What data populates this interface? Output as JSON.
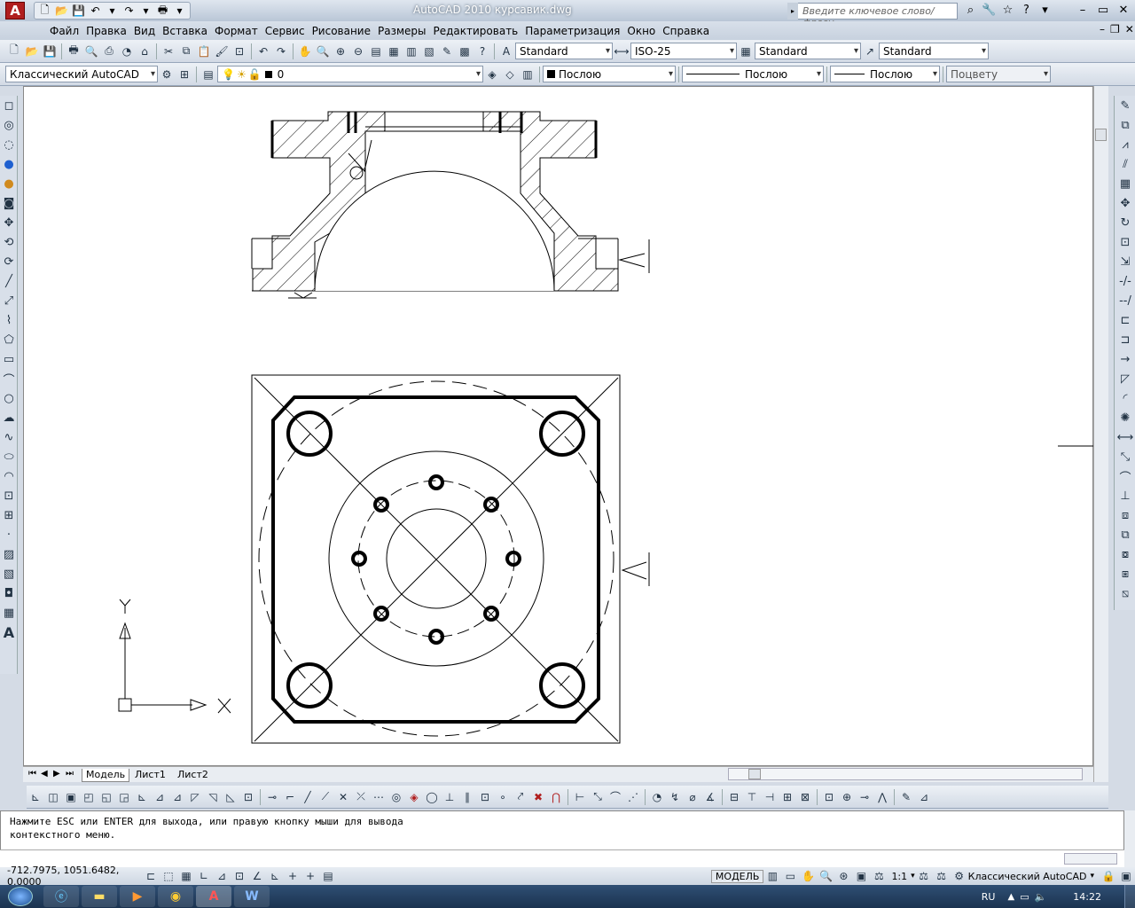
{
  "window": {
    "title": "AutoCAD 2010     курсавик.dwg",
    "search_placeholder": "Введите ключевое слово/фразу"
  },
  "app": {
    "logo_letter": "A"
  },
  "menu": [
    "Файл",
    "Правка",
    "Вид",
    "Вставка",
    "Формат",
    "Сервис",
    "Рисование",
    "Размеры",
    "Редактировать",
    "Параметризация",
    "Окно",
    "Справка"
  ],
  "styles_toolbar": {
    "text_style": "Standard",
    "dim_style": "ISO-25",
    "table_style": "Standard",
    "multileader_style": "Standard"
  },
  "layers_toolbar": {
    "workspace": "Классический AutoCAD",
    "layer": "0"
  },
  "properties_toolbar": {
    "color": "Послою",
    "linetype": "Послою",
    "lineweight": "Послою",
    "plot_style": "Поцвету"
  },
  "ucs": {
    "x_label": "X",
    "y_label": "Y"
  },
  "layout_tabs": [
    "Модель",
    "Лист1",
    "Лист2"
  ],
  "command": {
    "line1": "Нажмите ESC или ENTER для выхода, или правую кнопку мыши для вывода",
    "line2": "контекстного меню."
  },
  "status": {
    "coords": "-712.7975, 1051.6482, 0.0000",
    "model": "МОДЕЛЬ",
    "scale": "1:1",
    "workspace": "Классический AutoCAD"
  },
  "taskbar": {
    "lang": "RU",
    "clock": "14:22"
  },
  "colors": {
    "accent": "#b01e1e",
    "canvas": "#ffffff",
    "taskbar": "#1b3350"
  }
}
